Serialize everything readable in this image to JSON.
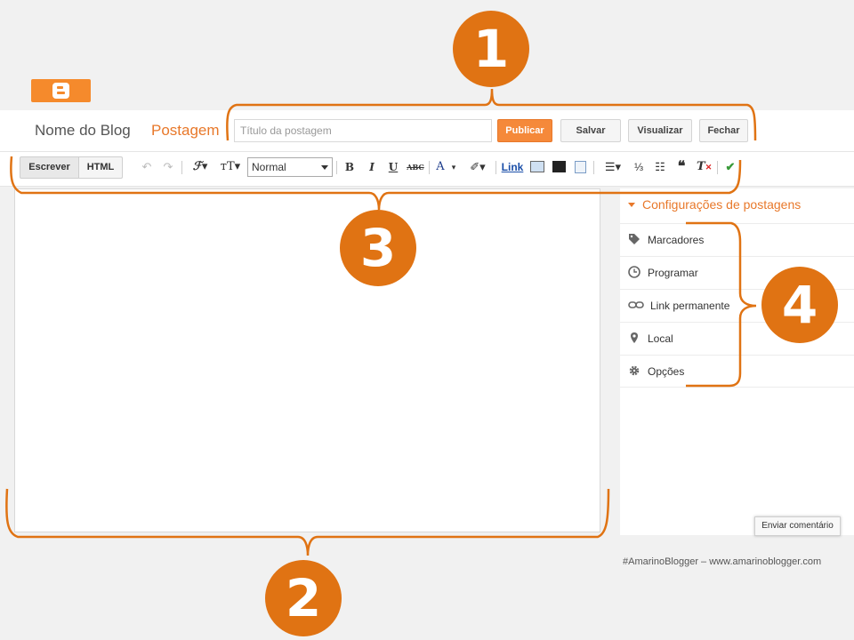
{
  "header": {
    "blog_name": "Nome do Blog",
    "section": "Postagem",
    "title_placeholder": "Título da postagem",
    "publish_label": "Publicar",
    "save_label": "Salvar",
    "preview_label": "Visualizar",
    "close_label": "Fechar"
  },
  "toolbar": {
    "mode_write": "Escrever",
    "mode_html": "HTML",
    "format_select": "Normal",
    "bold": "B",
    "italic": "I",
    "underline": "U",
    "strikethrough": "ABC",
    "text_color": "A",
    "link": "Link",
    "icons": [
      "undo-icon",
      "redo-icon",
      "font-icon",
      "font-size-icon",
      "image-icon",
      "video-icon",
      "jump-break-icon",
      "align-icon",
      "numbered-list-icon",
      "bullet-list-icon",
      "quote-icon",
      "remove-format-icon",
      "spellcheck-icon",
      "highlight-icon"
    ]
  },
  "sidebar": {
    "title": "Configurações de postagens",
    "items": [
      {
        "label": "Marcadores",
        "icon": "tag-icon"
      },
      {
        "label": "Programar",
        "icon": "clock-icon"
      },
      {
        "label": "Link permanente",
        "icon": "link-icon"
      },
      {
        "label": "Local",
        "icon": "location-pin-icon"
      },
      {
        "label": "Opções",
        "icon": "gear-icon"
      }
    ]
  },
  "feedback_label": "Enviar comentário",
  "credit": "#AmarinoBlogger – www.amarinoblogger.com",
  "callouts": [
    "1",
    "2",
    "3",
    "4"
  ],
  "colors": {
    "accent": "#e8782a",
    "callout": "#e07313",
    "blogger_orange": "#f58a2c"
  }
}
